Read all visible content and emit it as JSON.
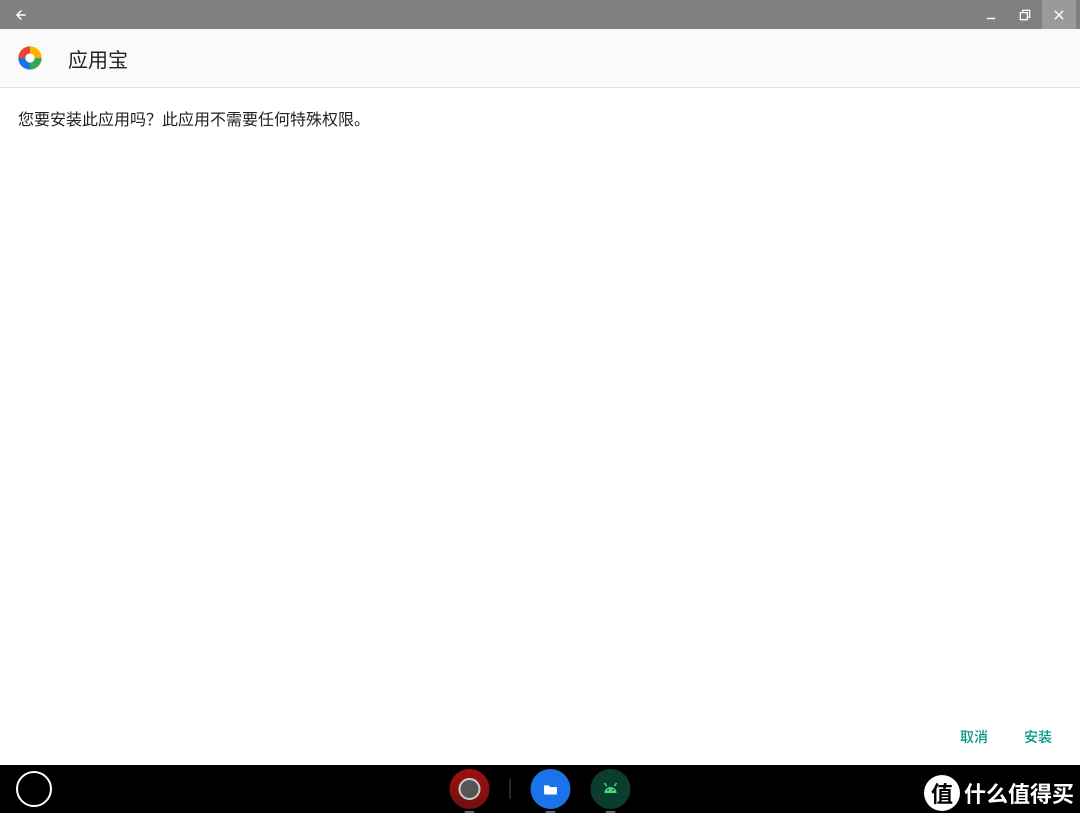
{
  "titlebar": {
    "back_icon": "arrow-left",
    "minimize_icon": "minimize",
    "restore_icon": "restore-window",
    "close_icon": "close"
  },
  "header": {
    "app_name": "应用宝",
    "app_icon": "yingyongbao-swirl"
  },
  "content": {
    "install_message": "您要安装此应用吗？此应用不需要任何特殊权限。"
  },
  "actions": {
    "cancel_label": "取消",
    "install_label": "安装"
  },
  "taskbar": {
    "launcher_icon": "circle-launcher",
    "apps": [
      {
        "name": "phone-app",
        "icon": "phone",
        "running": true
      },
      {
        "name": "files-app",
        "icon": "folder",
        "running": true
      },
      {
        "name": "android-app",
        "icon": "android-head",
        "running": true
      }
    ]
  },
  "watermark": {
    "badge": "值",
    "text": "什么值得买"
  },
  "colors": {
    "accent": "#009688",
    "titlebar": "#808080",
    "header_bg": "#fafafa",
    "border": "#e0e0e0"
  }
}
